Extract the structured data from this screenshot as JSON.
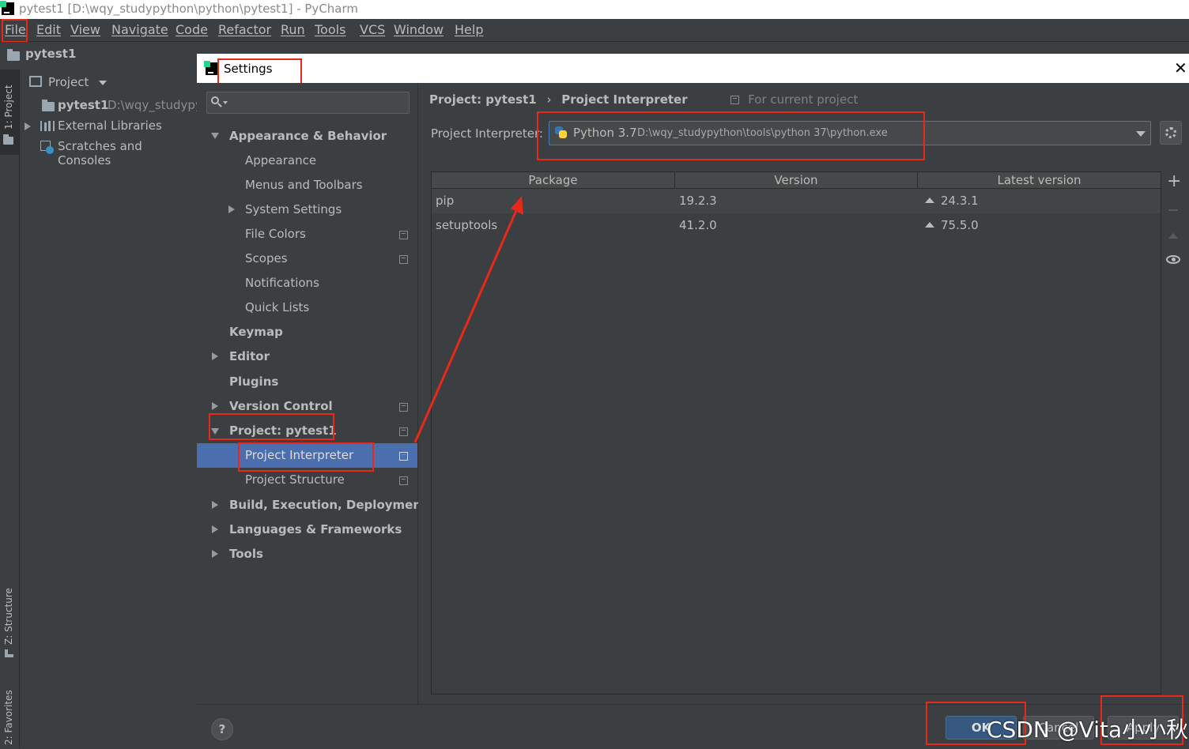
{
  "window": {
    "title": "pytest1 [D:\\wqy_studypython\\python\\pytest1] - PyCharm"
  },
  "menu": [
    "File",
    "Edit",
    "View",
    "Navigate",
    "Code",
    "Refactor",
    "Run",
    "Tools",
    "VCS",
    "Window",
    "Help"
  ],
  "navbar": {
    "project": "pytest1"
  },
  "stripe": {
    "project_tab": "1: Project",
    "structure_tab": "Z: Structure",
    "favorites_tab": "2: Favorites"
  },
  "project_pane": {
    "header": "Project",
    "items": [
      {
        "name": "pytest1",
        "path": "D:\\wqy_studypy"
      },
      {
        "name": "External Libraries"
      },
      {
        "name": "Scratches and Consoles"
      }
    ]
  },
  "dialog": {
    "title": "Settings",
    "search_placeholder": "",
    "tree": [
      {
        "label": "Appearance & Behavior",
        "level": 0,
        "expanded": true,
        "bold": true
      },
      {
        "label": "Appearance",
        "level": 1
      },
      {
        "label": "Menus and Toolbars",
        "level": 1
      },
      {
        "label": "System Settings",
        "level": 1,
        "expandable": true
      },
      {
        "label": "File Colors",
        "level": 1,
        "project_icon": true
      },
      {
        "label": "Scopes",
        "level": 1,
        "project_icon": true
      },
      {
        "label": "Notifications",
        "level": 1
      },
      {
        "label": "Quick Lists",
        "level": 1
      },
      {
        "label": "Keymap",
        "level": 0,
        "bold": true
      },
      {
        "label": "Editor",
        "level": 0,
        "bold": true,
        "expandable": true
      },
      {
        "label": "Plugins",
        "level": 0,
        "bold": true
      },
      {
        "label": "Version Control",
        "level": 0,
        "bold": true,
        "expandable": true,
        "project_icon": true
      },
      {
        "label": "Project: pytest1",
        "level": 0,
        "bold": true,
        "expanded": true,
        "project_icon": true
      },
      {
        "label": "Project Interpreter",
        "level": 1,
        "selected": true,
        "project_icon": true
      },
      {
        "label": "Project Structure",
        "level": 1,
        "project_icon": true
      },
      {
        "label": "Build, Execution, Deployment",
        "level": 0,
        "bold": true,
        "expandable": true
      },
      {
        "label": "Languages & Frameworks",
        "level": 0,
        "bold": true,
        "expandable": true
      },
      {
        "label": "Tools",
        "level": 0,
        "bold": true,
        "expandable": true
      }
    ],
    "breadcrumb": {
      "parent": "Project: pytest1",
      "separator": "›",
      "current": "Project Interpreter",
      "scope": "For current project"
    },
    "interpreter": {
      "label": "Project Interpreter:",
      "name": "Python 3.7",
      "path": "D:\\wqy_studypython\\tools\\python 37\\python.exe"
    },
    "table": {
      "columns": [
        "Package",
        "Version",
        "Latest version"
      ],
      "rows": [
        {
          "package": "pip",
          "version": "19.2.3",
          "latest": "24.3.1"
        },
        {
          "package": "setuptools",
          "version": "41.2.0",
          "latest": "75.5.0"
        }
      ]
    },
    "buttons": {
      "ok": "OK",
      "cancel": "Cancel",
      "apply": "Apply",
      "help": "?"
    }
  },
  "watermark": "CSDN @Vita小小秋",
  "colors": {
    "accent_selected": "#4b6eaf",
    "annotation_red": "#e8291a",
    "python_blue": "#3776ab",
    "python_yellow": "#ffd43b"
  }
}
